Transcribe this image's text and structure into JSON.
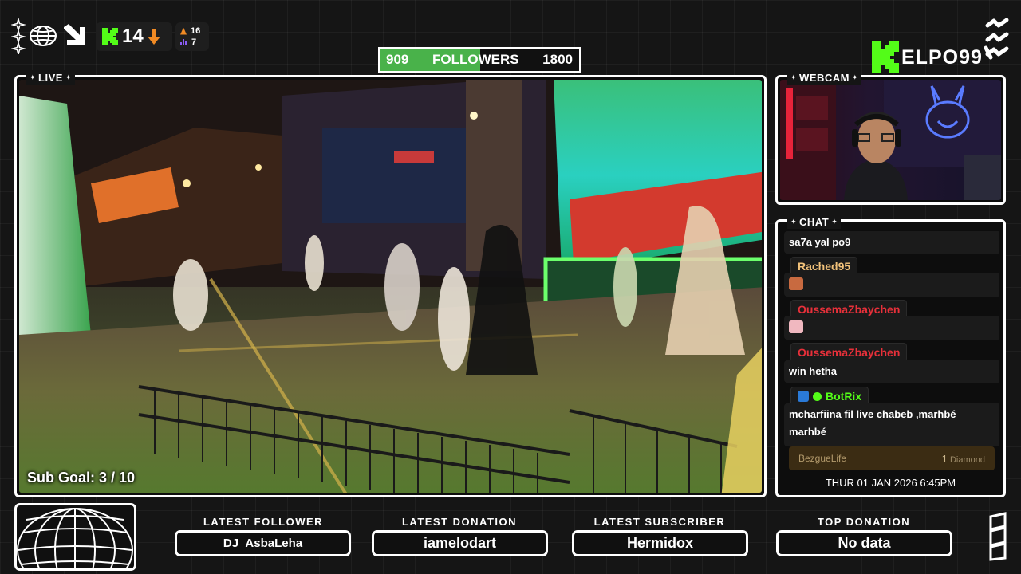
{
  "header": {
    "viewer_count": "14",
    "stat_top": "16",
    "stat_bottom": "7"
  },
  "followers_goal": {
    "current": "909",
    "label": "FOLLOWERS",
    "target": "1800",
    "progress": 0.505
  },
  "brand": {
    "name": "ELPO99"
  },
  "panels": {
    "live_tag": "LIVE",
    "webcam_tag": "WEBCAM",
    "chat_tag": "CHAT"
  },
  "live": {
    "sub_goal": "Sub Goal:  3 / 10"
  },
  "chat": {
    "messages": [
      {
        "text": "sa7a yal po9"
      },
      {
        "user": "Rached95",
        "user_color": "#f2c27a"
      },
      {
        "user": "OussemaZbaychen",
        "user_color": "#e8303a"
      },
      {
        "user": "OussemaZbaychen",
        "user_color": "#e8303a",
        "text": "win hetha"
      },
      {
        "user": "BotRix",
        "user_color": "#53fc18",
        "text": "mcharfiina fil live chabeb ,marhbé marhbé"
      }
    ],
    "donation": {
      "user": "BezgueLife",
      "amount": "1",
      "unit": "Diamond"
    },
    "timestamp": "THUR 01 JAN 2026 6:45PM"
  },
  "bottom": {
    "latest_follower": {
      "label": "LATEST FOLLOWER",
      "value": "DJ_AsbaLeha"
    },
    "latest_donation": {
      "label": "LATEST DONATION",
      "value": "iamelodart"
    },
    "latest_subscriber": {
      "label": "LATEST SUBSCRIBER",
      "value": "Hermidox"
    },
    "top_donation": {
      "label": "TOP DONATION",
      "value": "No data"
    }
  },
  "colors": {
    "kick_green": "#53fc18",
    "progress_green": "#49b24a",
    "accent_orange": "#f08a24",
    "accent_purple": "#8a5cf5",
    "chat_red": "#e8303a",
    "chat_gold": "#f2c27a"
  }
}
